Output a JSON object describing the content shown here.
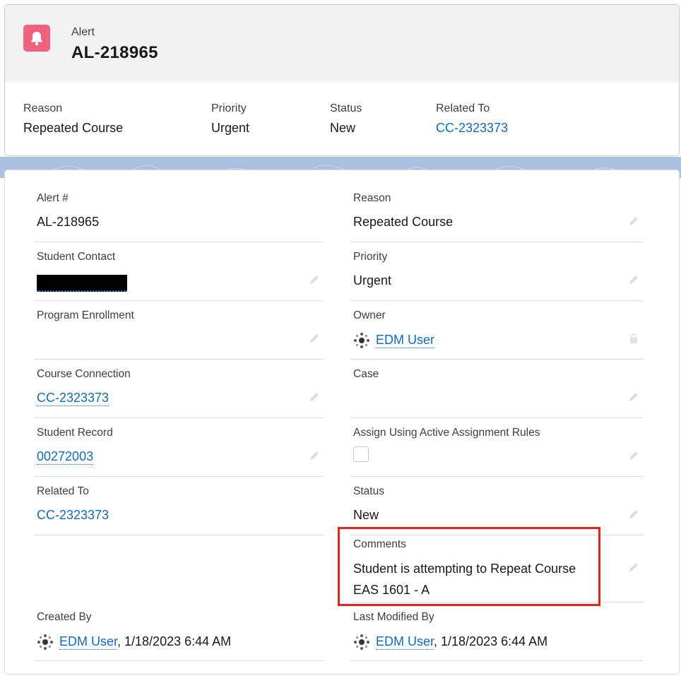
{
  "header": {
    "object_type": "Alert",
    "record_name": "AL-218965",
    "highlights": [
      {
        "label": "Reason",
        "value": "Repeated Course"
      },
      {
        "label": "Priority",
        "value": "Urgent"
      },
      {
        "label": "Status",
        "value": "New"
      },
      {
        "label": "Related To",
        "value": "CC-2323373"
      }
    ]
  },
  "details": {
    "alert_number": {
      "label": "Alert #",
      "value": "AL-218965"
    },
    "reason": {
      "label": "Reason",
      "value": "Repeated Course"
    },
    "student_contact": {
      "label": "Student Contact",
      "value": ""
    },
    "priority": {
      "label": "Priority",
      "value": "Urgent"
    },
    "program_enrollment": {
      "label": "Program Enrollment",
      "value": ""
    },
    "owner": {
      "label": "Owner",
      "value": "EDM User"
    },
    "course_connection": {
      "label": "Course Connection",
      "value": "CC-2323373"
    },
    "case": {
      "label": "Case",
      "value": ""
    },
    "student_record": {
      "label": "Student Record",
      "value": "00272003"
    },
    "assign_rules": {
      "label": "Assign Using Active Assignment Rules",
      "checked": false
    },
    "related_to": {
      "label": "Related To",
      "value": "CC-2323373"
    },
    "status": {
      "label": "Status",
      "value": "New"
    },
    "comments": {
      "label": "Comments",
      "value": "Student is attempting to Repeat Course EAS 1601 - A"
    },
    "created_by": {
      "label": "Created By",
      "user": "EDM User",
      "date": ", 1/18/2023 6:44 AM"
    },
    "last_modified_by": {
      "label": "Last Modified By",
      "user": "EDM User",
      "date": ", 1/18/2023 6:44 AM"
    }
  },
  "colors": {
    "icon_bg": "#f0617b",
    "link": "#0b6bcb",
    "highlight_border": "#e2231a",
    "band": "#a9c0e2"
  },
  "icons": {
    "object": "bell-icon",
    "edit": "pencil-icon",
    "user": "user-avatar-icon",
    "lock": "lock-icon"
  }
}
